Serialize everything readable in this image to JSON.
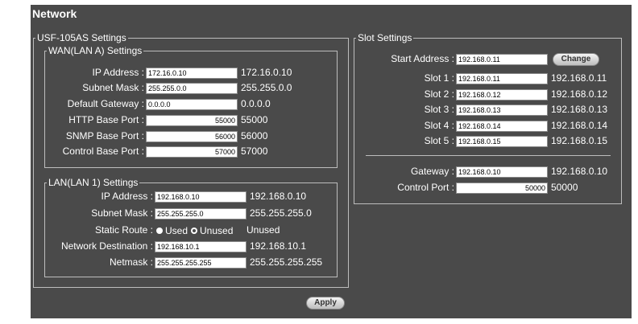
{
  "page": {
    "title": "Network",
    "apply_label": "Apply"
  },
  "usf": {
    "legend": "USF-105AS Settings",
    "wan": {
      "legend": "WAN(LAN A) Settings",
      "rows": [
        {
          "label": "IP Address :",
          "input": "172.16.0.10",
          "value": "172.16.0.10"
        },
        {
          "label": "Subnet Mask :",
          "input": "255.255.0.0",
          "value": "255.255.0.0"
        },
        {
          "label": "Default Gateway :",
          "input": "0.0.0.0",
          "value": "0.0.0.0"
        },
        {
          "label": "HTTP Base Port :",
          "input": "55000",
          "value": "55000"
        },
        {
          "label": "SNMP Base Port :",
          "input": "56000",
          "value": "56000"
        },
        {
          "label": "Control Base Port :",
          "input": "57000",
          "value": "57000"
        }
      ]
    },
    "lan": {
      "legend": "LAN(LAN 1) Settings",
      "ip": {
        "label": "IP Address :",
        "input": "192.168.0.10",
        "value": "192.168.0.10"
      },
      "mask": {
        "label": "Subnet Mask :",
        "input": "255.255.255.0",
        "value": "255.255.255.0"
      },
      "route": {
        "label": "Static Route :",
        "used": "Used",
        "unused": "Unused",
        "value": "Unused"
      },
      "dest": {
        "label": "Network Destination :",
        "input": "192.168.10.1",
        "value": "192.168.10.1"
      },
      "netmask": {
        "label": "Netmask :",
        "input": "255.255.255.255",
        "value": "255.255.255.255"
      }
    }
  },
  "slot": {
    "legend": "Slot Settings",
    "start": {
      "label": "Start Address :",
      "input": "192.168.0.11",
      "button": "Change"
    },
    "slots": [
      {
        "label": "Slot 1 :",
        "input": "192.168.0.11",
        "value": "192.168.0.11"
      },
      {
        "label": "Slot 2 :",
        "input": "192.168.0.12",
        "value": "192.168.0.12"
      },
      {
        "label": "Slot 3 :",
        "input": "192.168.0.13",
        "value": "192.168.0.13"
      },
      {
        "label": "Slot 4 :",
        "input": "192.168.0.14",
        "value": "192.168.0.14"
      },
      {
        "label": "Slot 5 :",
        "input": "192.168.0.15",
        "value": "192.168.0.15"
      }
    ],
    "gateway": {
      "label": "Gateway :",
      "input": "192.168.0.10",
      "value": "192.168.0.10"
    },
    "control": {
      "label": "Control Port :",
      "input": "50000",
      "value": "50000"
    }
  },
  "colors": {
    "panel": "#4a4a4a",
    "border": "#bdbdbd"
  }
}
